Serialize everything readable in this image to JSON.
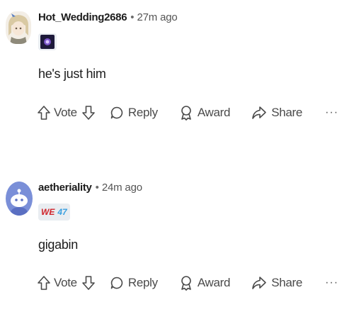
{
  "comments": [
    {
      "username": "Hot_Wedding2686",
      "separator": "•",
      "time": "27m ago",
      "text": "he's just him",
      "actions": {
        "vote": "Vote",
        "reply": "Reply",
        "award": "Award",
        "share": "Share",
        "more": "···"
      }
    },
    {
      "username": "aetheriality",
      "separator": "•",
      "time": "24m ago",
      "flair_text": [
        "WE",
        "47"
      ],
      "text": "gigabin",
      "actions": {
        "vote": "Vote",
        "reply": "Reply",
        "award": "Award",
        "share": "Share",
        "more": "···"
      }
    }
  ]
}
